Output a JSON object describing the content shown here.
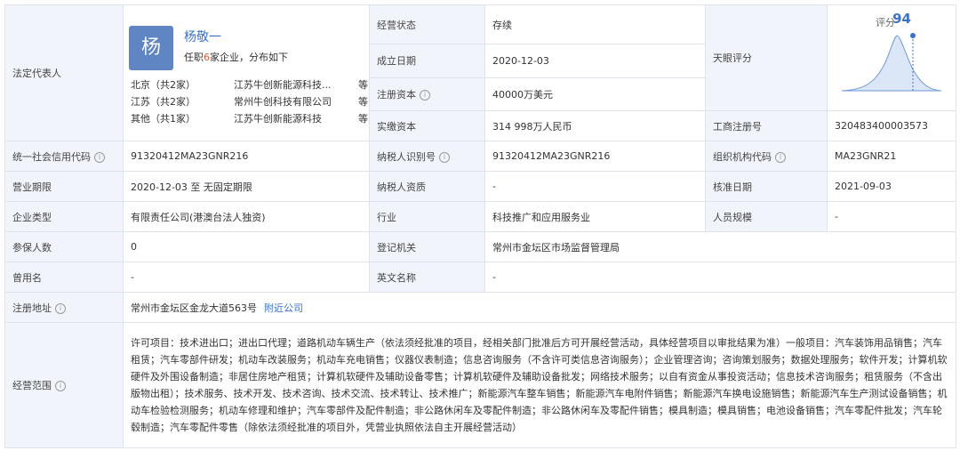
{
  "legal_rep": {
    "label": "法定代表人",
    "avatar_char": "杨",
    "name": "杨敬一",
    "summary_pre": "任职",
    "summary_count": "6",
    "summary_post": "家企业，分布如下",
    "regions": [
      {
        "region": "北京（共2家）",
        "company": "江苏牛创新能源科技...",
        "suffix": "等"
      },
      {
        "region": "江苏（共2家）",
        "company": "常州牛创科技有限公司",
        "suffix": "等"
      },
      {
        "region": "其他（共1家）",
        "company": "江苏牛创新能源科技",
        "suffix": "等"
      }
    ]
  },
  "status": {
    "label": "经营状态",
    "value": "存续"
  },
  "founded": {
    "label": "成立日期",
    "value": "2020-12-03"
  },
  "reg_capital": {
    "label": "注册资本",
    "value": "40000万美元"
  },
  "paid_capital": {
    "label": "实缴资本",
    "value": "314 998万人民币"
  },
  "tianyan": {
    "label": "天眼评分",
    "score_label": "评分",
    "score": "94"
  },
  "reg_no": {
    "label": "工商注册号",
    "value": "320483400003573"
  },
  "credit_code": {
    "label": "统一社会信用代码",
    "value": "91320412MA23GNR216"
  },
  "taxpayer_id": {
    "label": "纳税人识别号",
    "value": "91320412MA23GNR216"
  },
  "org_code": {
    "label": "组织机构代码",
    "value": "MA23GNR21"
  },
  "term": {
    "label": "营业期限",
    "value": "2020-12-03  至  无固定期限"
  },
  "taxpayer_qual": {
    "label": "纳税人资质",
    "value": "-"
  },
  "approval_date": {
    "label": "核准日期",
    "value": "2021-09-03"
  },
  "company_type": {
    "label": "企业类型",
    "value": "有限责任公司(港澳台法人独资)"
  },
  "industry": {
    "label": "行业",
    "value": "科技推广和应用服务业"
  },
  "staff_size": {
    "label": "人员规模",
    "value": "-"
  },
  "insured": {
    "label": "参保人数",
    "value": "0"
  },
  "reg_authority": {
    "label": "登记机关",
    "value": "常州市金坛区市场监督管理局"
  },
  "former_name": {
    "label": "曾用名",
    "value": "-"
  },
  "english_name": {
    "label": "英文名称",
    "value": "-"
  },
  "address": {
    "label": "注册地址",
    "value": "常州市金坛区金龙大道563号",
    "link": "附近公司"
  },
  "scope": {
    "label": "经营范围",
    "value": "许可项目：技术进出口；进出口代理；道路机动车辆生产（依法须经批准的项目，经相关部门批准后方可开展经营活动，具体经营项目以审批结果为准）一般项目：汽车装饰用品销售；汽车租赁；汽车零部件研发；机动车改装服务；机动车充电销售；仪器仪表制造；信息咨询服务（不含许可类信息咨询服务）；企业管理咨询；咨询策划服务；数据处理服务；软件开发；计算机软硬件及外围设备制造；非居住房地产租赁；计算机软硬件及辅助设备零售；计算机软硬件及辅助设备批发；网络技术服务；以自有资金从事投资活动；信息技术咨询服务；租赁服务（不含出版物出租）；技术服务、技术开发、技术咨询、技术交流、技术转让、技术推广；新能源汽车整车销售；新能源汽车电附件销售；新能源汽车换电设施销售；新能源汽车生产测试设备销售；机动车检验检测服务；机动车修理和维护；汽车零部件及配件制造；非公路休闲车及零配件制造；非公路休闲车及零配件销售；模具制造；模具销售；电池设备销售；汽车零配件批发；汽车轮毂制造；汽车零配件零售（除依法须经批准的项目外，凭营业执照依法自主开展经营活动）"
  }
}
